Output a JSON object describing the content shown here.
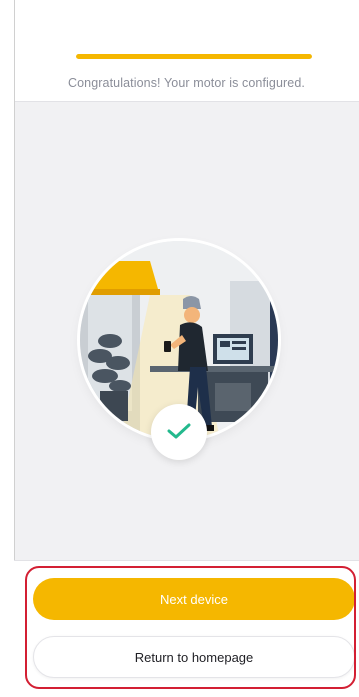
{
  "header": {
    "progress_percent": 100,
    "message": "Congratulations! Your motor is configured."
  },
  "illustration": {
    "description_icon": "person-with-phone-illustration",
    "check_icon": "checkmark-icon"
  },
  "actions": {
    "next_label": "Next device",
    "home_label": "Return to homepage"
  },
  "colors": {
    "accent": "#f5b700",
    "check": "#23b98d",
    "highlight": "#d31f33"
  }
}
